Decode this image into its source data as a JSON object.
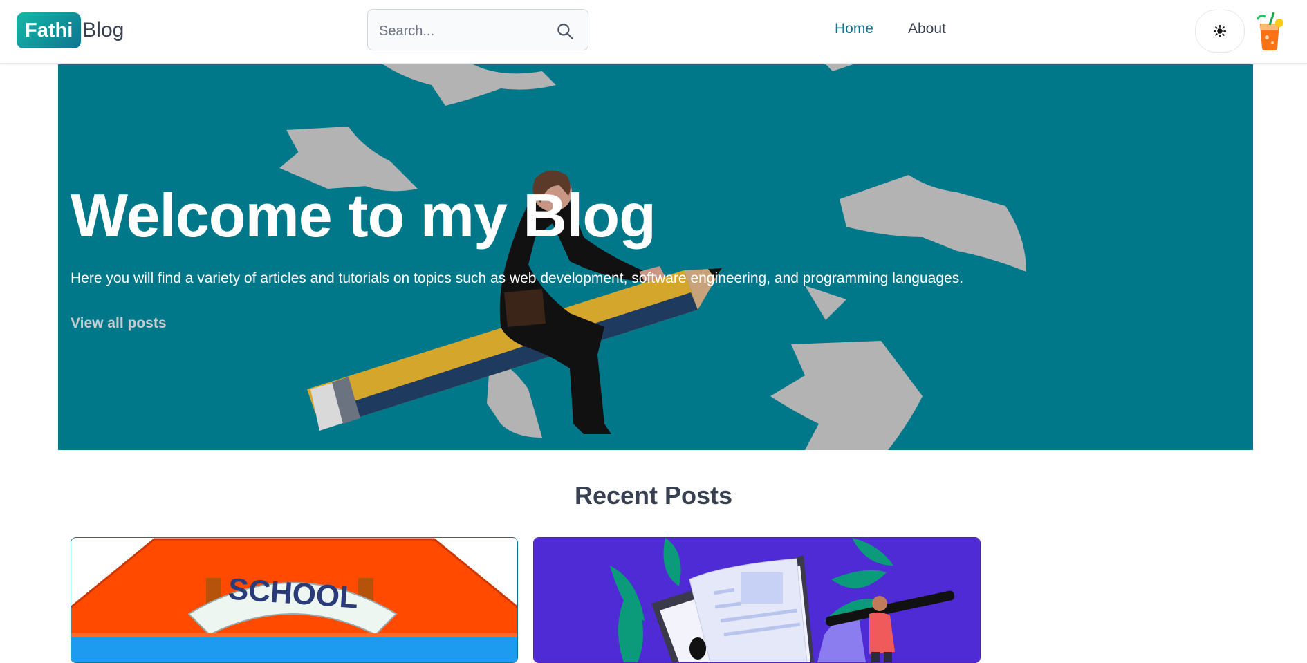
{
  "header": {
    "logo_badge": "Fathi",
    "logo_text": "Blog",
    "search_placeholder": "Search...",
    "nav": [
      {
        "label": "Home",
        "active": true
      },
      {
        "label": "About",
        "active": false
      }
    ],
    "theme_icon": "sun-icon",
    "avatar_icon": "drink-icon"
  },
  "hero": {
    "title": "Welcome to my Blog",
    "text": "Here you will find a variety of articles and tutorials on topics such as web development, software engineering, and programming languages.",
    "link": "View all posts",
    "background_color": "#00788a"
  },
  "recent": {
    "title": "Recent Posts",
    "cards": [
      {
        "image_label": "SCHOOL",
        "image_icon": "school-illustration"
      },
      {
        "image_icon": "writing-illustration"
      }
    ]
  },
  "colors": {
    "accent": "#0e7490",
    "logo_gradient_start": "#14b8a6"
  }
}
